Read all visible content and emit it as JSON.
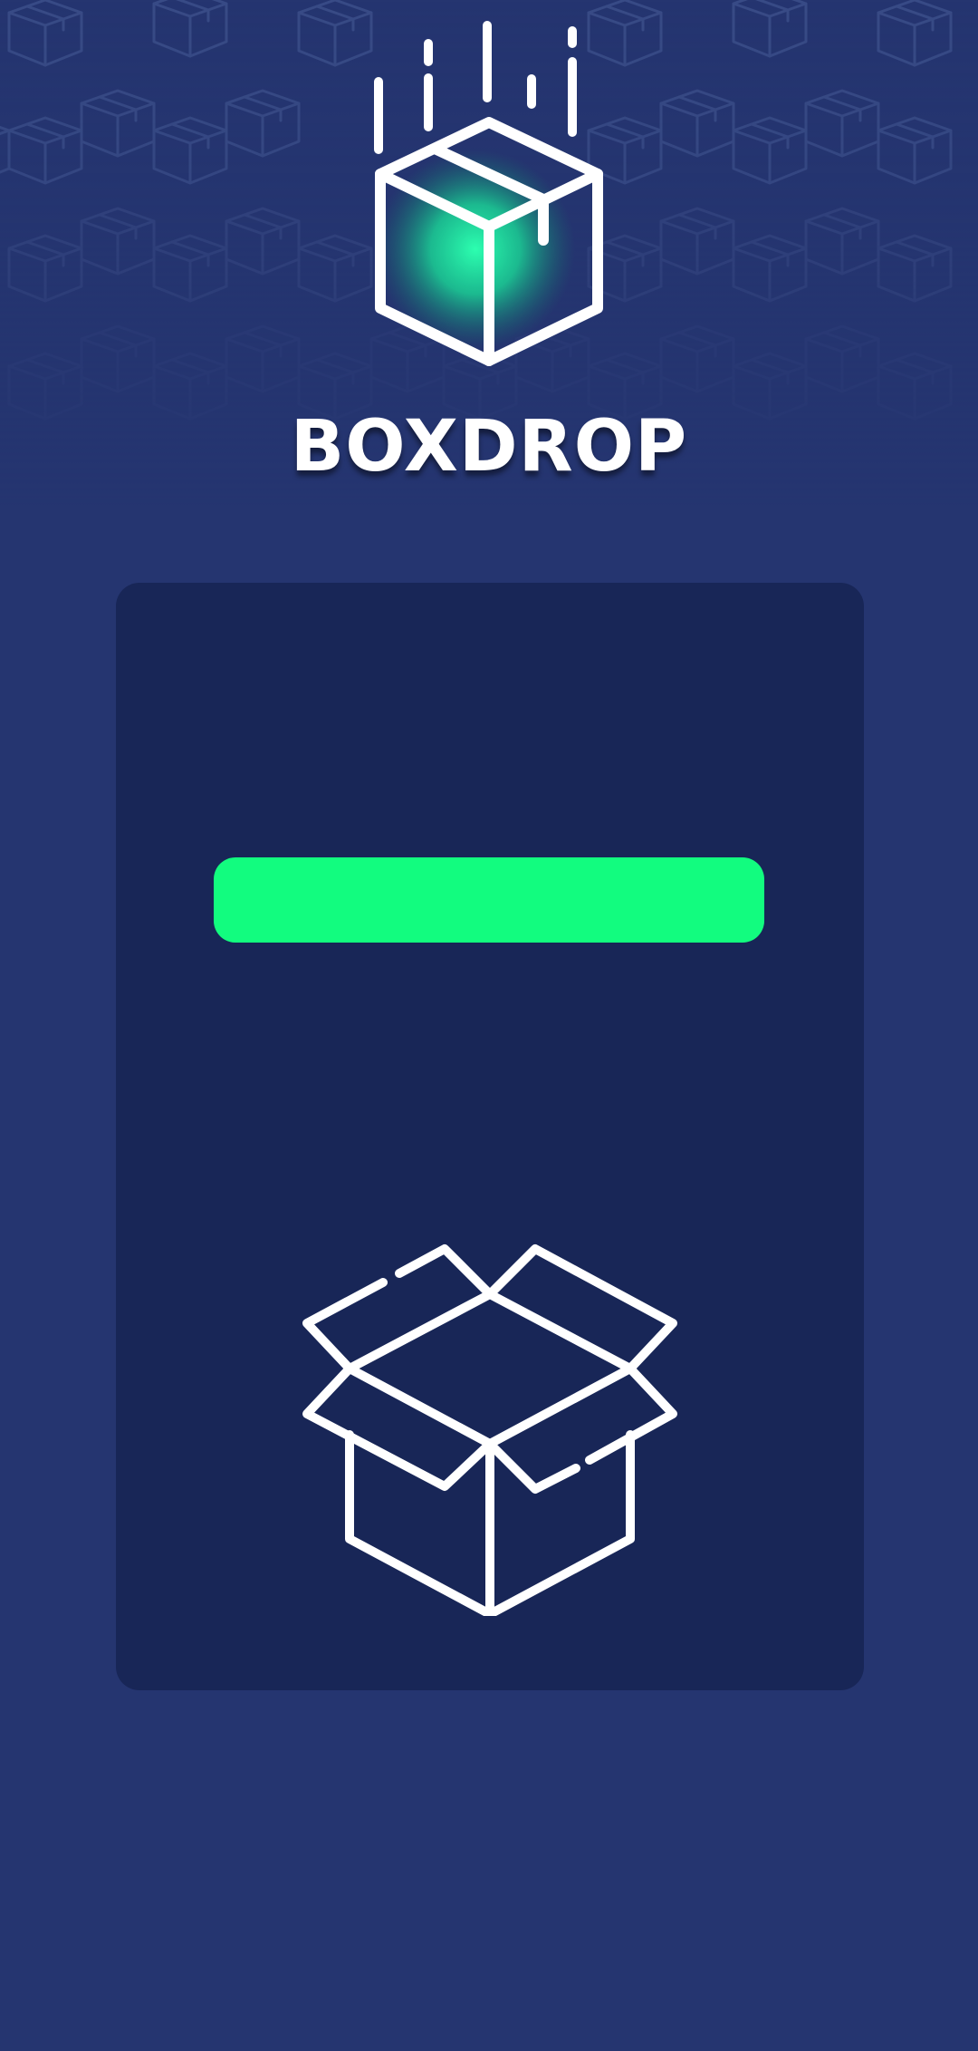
{
  "app": {
    "title": "BOXDROP"
  },
  "icons": {
    "header_pattern": "box-pattern-icon",
    "logo": "falling-box-logo-icon",
    "panel_graphic": "open-box-icon"
  },
  "loading": {
    "progress": 1.0
  },
  "colors": {
    "background": "#253570",
    "panel": "#182657",
    "accent": "#12fc7f",
    "text": "#ffffff"
  }
}
